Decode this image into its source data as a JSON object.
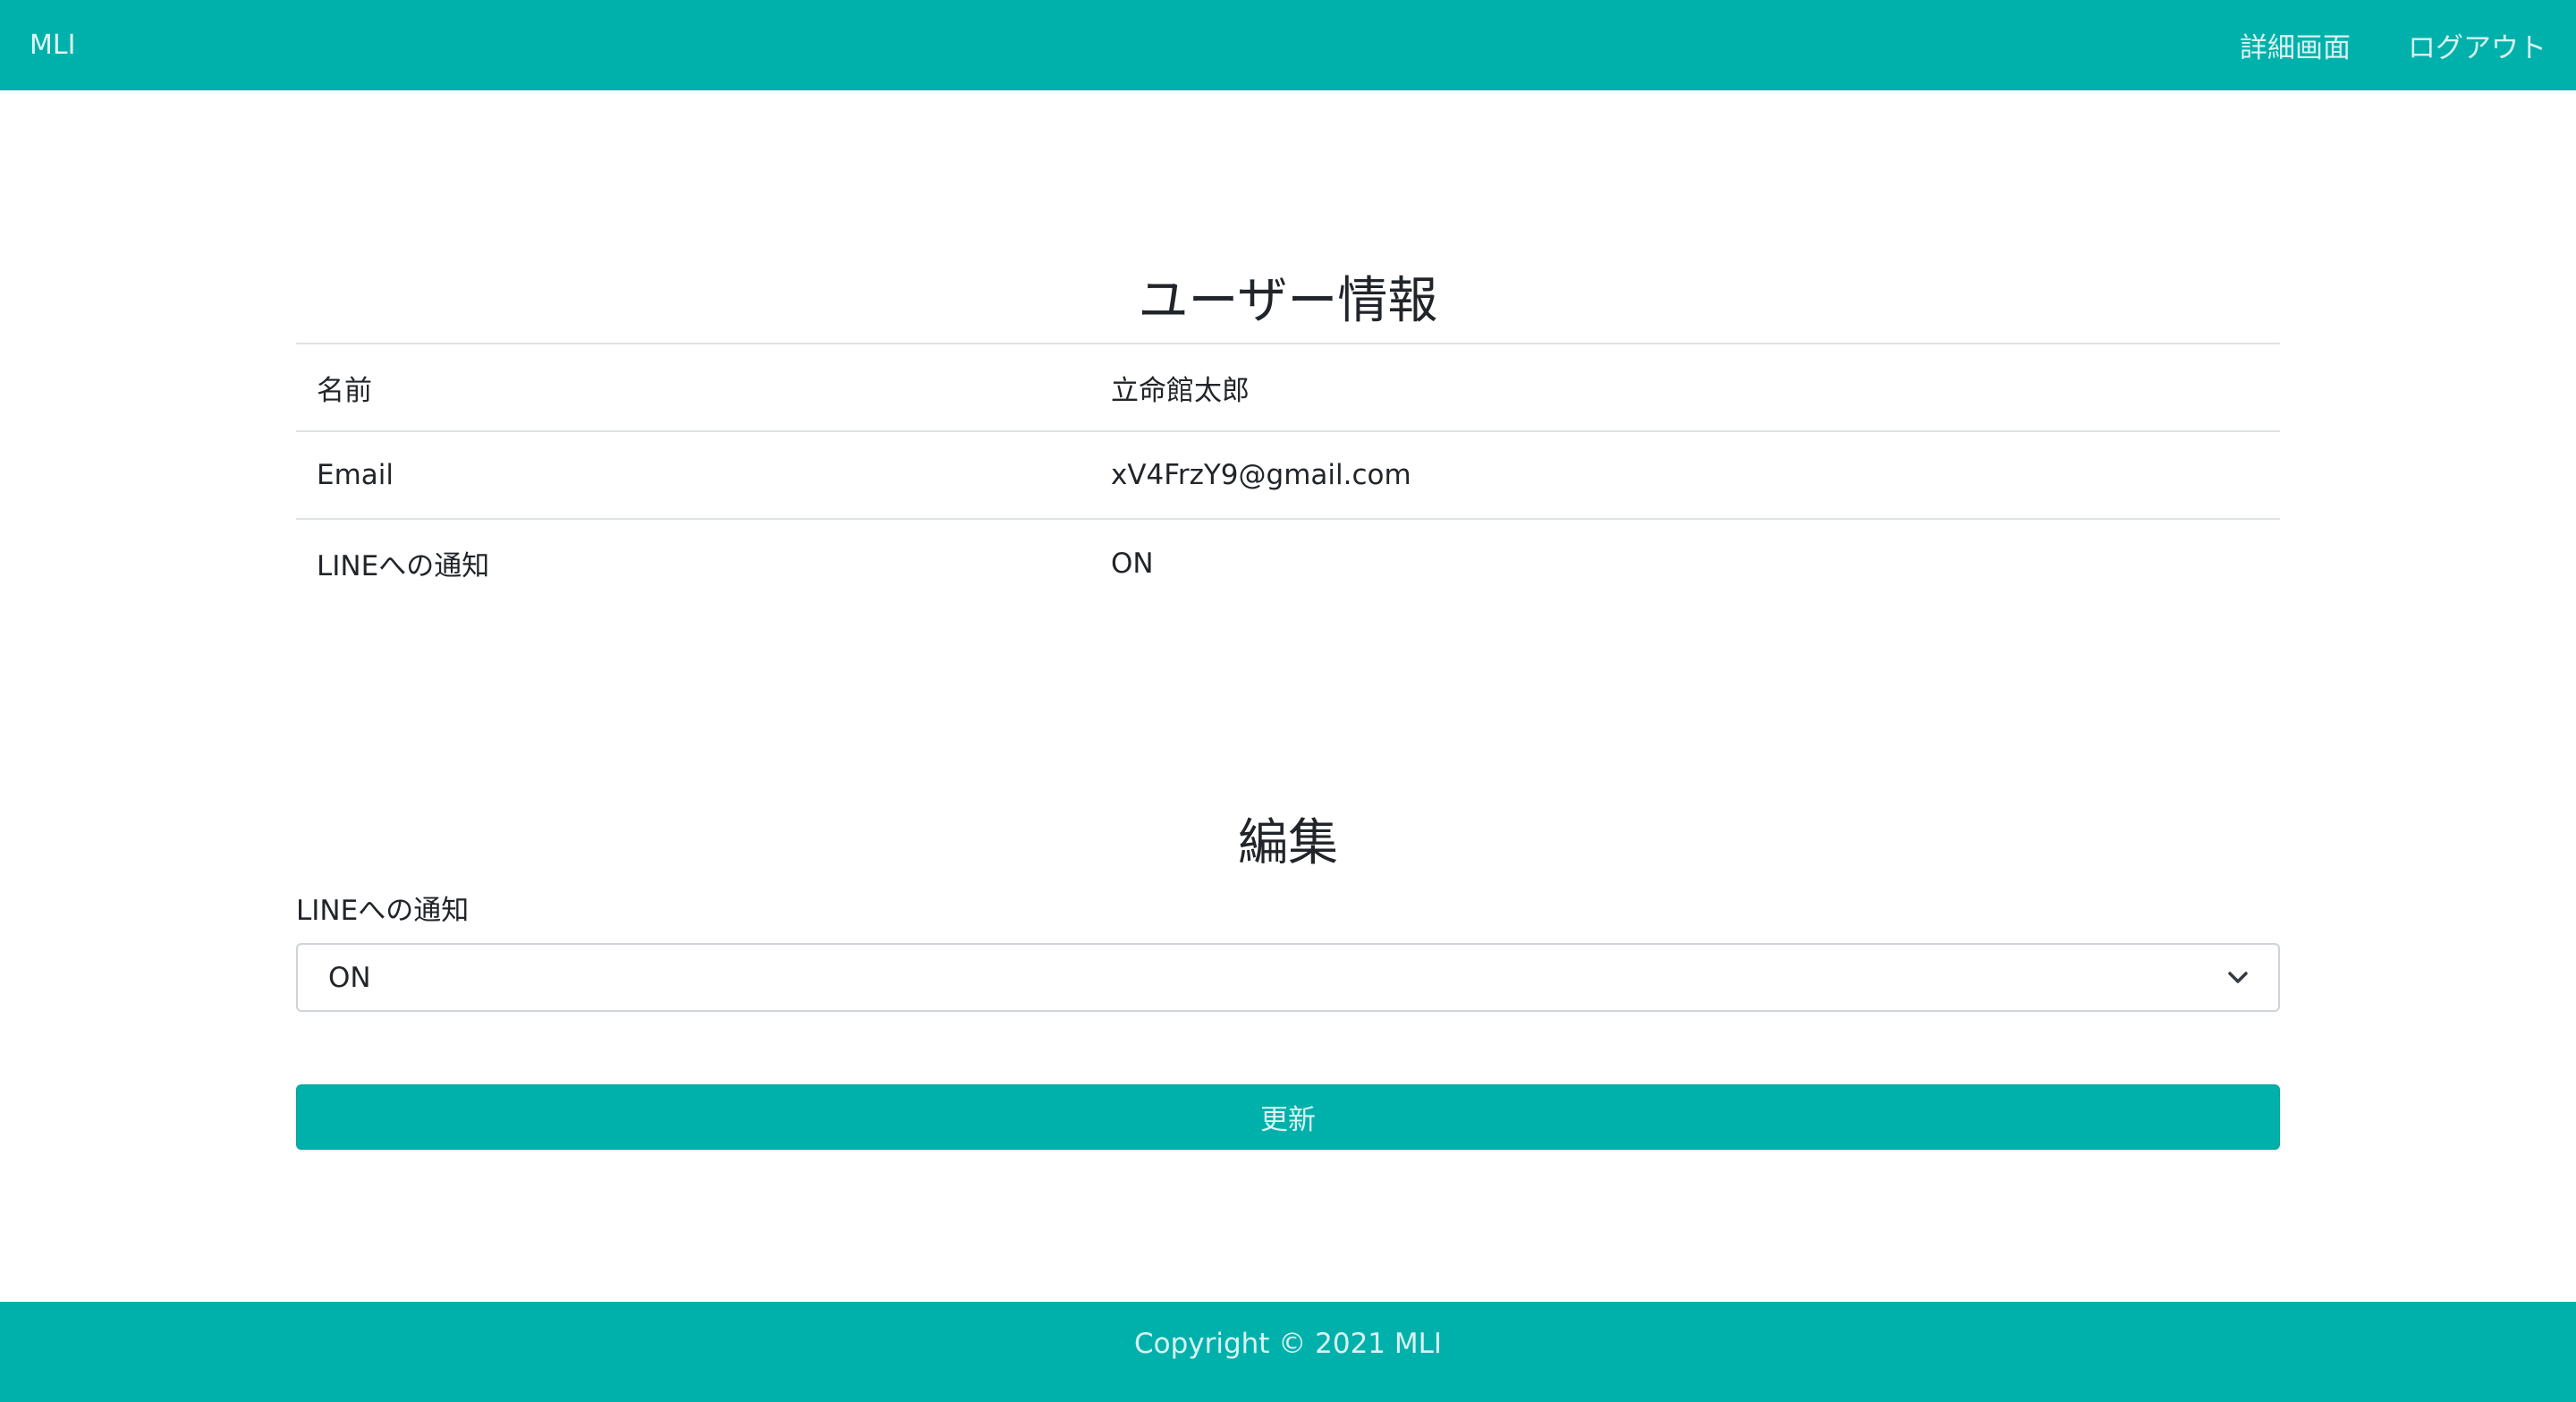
{
  "header": {
    "brand": "MLI",
    "nav": [
      {
        "label": "詳細画面"
      },
      {
        "label": "ログアウト"
      }
    ]
  },
  "user_info": {
    "title": "ユーザー情報",
    "rows": [
      {
        "label": "名前",
        "value": "立命館太郎"
      },
      {
        "label": "Email",
        "value": "xV4FrzY9@gmail.com"
      },
      {
        "label": "LINEへの通知",
        "value": "ON"
      }
    ]
  },
  "edit": {
    "title": "編集",
    "field_label": "LINEへの通知",
    "select_value": "ON",
    "submit_label": "更新"
  },
  "footer": {
    "text": "Copyright © 2021 MLI"
  },
  "colors": {
    "accent": "#00b1ab",
    "border": "#dee2e6"
  }
}
